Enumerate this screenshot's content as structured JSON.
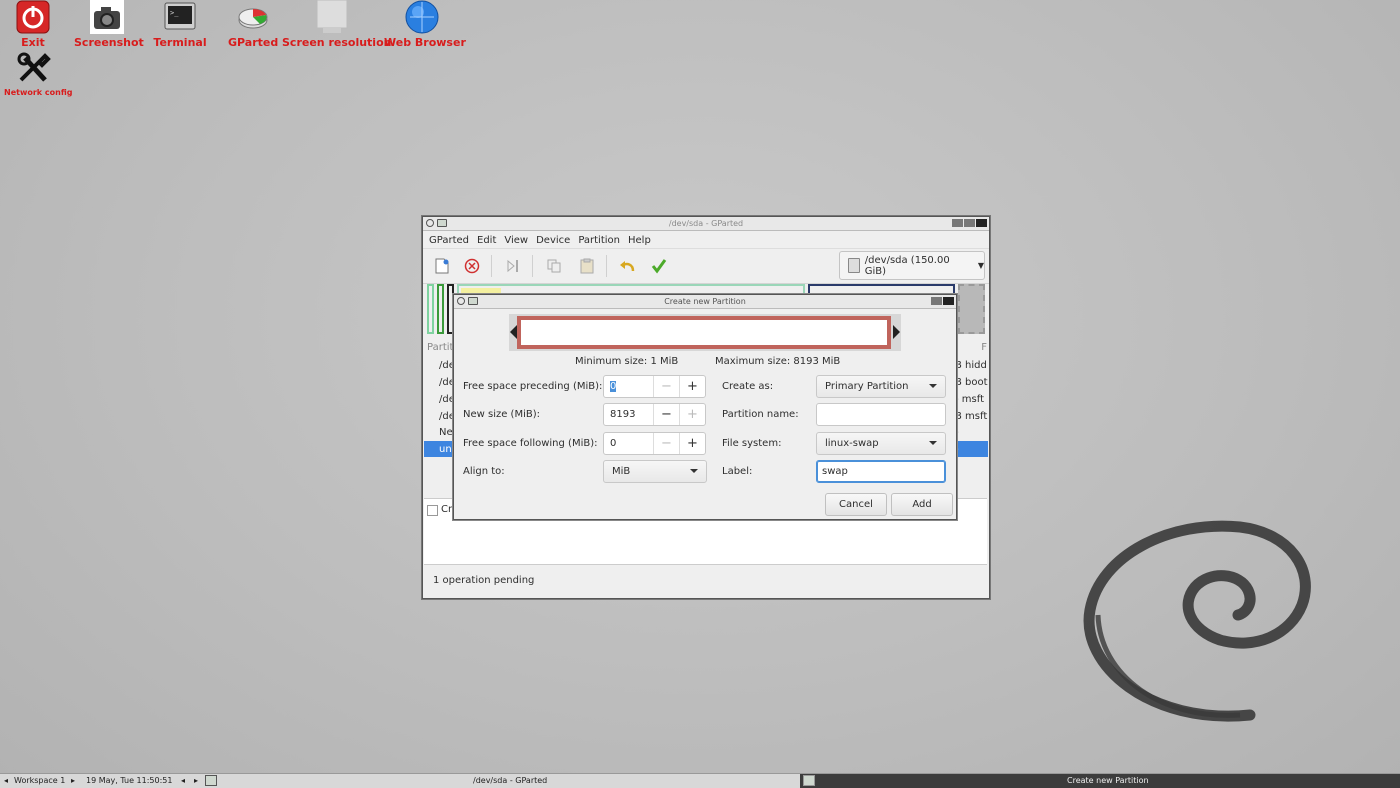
{
  "desktop": {
    "icons": [
      {
        "label": "Exit"
      },
      {
        "label": "Screenshot"
      },
      {
        "label": "Terminal"
      },
      {
        "label": "GParted"
      },
      {
        "label": "Screen resolution"
      },
      {
        "label": "Web Browser"
      },
      {
        "label": "Network config"
      }
    ]
  },
  "main_window": {
    "title": "/dev/sda - GParted",
    "menu": [
      "GParted",
      "Edit",
      "View",
      "Device",
      "Partition",
      "Help"
    ],
    "device_selector": "/dev/sda (150.00 GiB)",
    "list_header_left": "Partiti",
    "list_header_right": "F",
    "rows": [
      {
        "left": "/dev",
        "right": "B  hidd"
      },
      {
        "left": "/dev",
        "right": "B  boot"
      },
      {
        "left": "/dev",
        "right": "-  msft"
      },
      {
        "left": "/dev",
        "right": "B  msft"
      },
      {
        "left": "Nev",
        "right": "-"
      },
      {
        "left": "una",
        "right": "-"
      }
    ],
    "pending_op": "Cre",
    "status": "1 operation pending"
  },
  "dialog": {
    "title": "Create new Partition",
    "min_size": "Minimum size: 1 MiB",
    "max_size": "Maximum size: 8193 MiB",
    "labels": {
      "free_before": "Free space preceding (MiB):",
      "new_size": "New size (MiB):",
      "free_after": "Free space following (MiB):",
      "align": "Align to:",
      "create_as": "Create as:",
      "partition_name": "Partition name:",
      "file_system": "File system:",
      "label": "Label:"
    },
    "values": {
      "free_before": "0",
      "new_size": "8193",
      "free_after": "0",
      "align": "MiB",
      "create_as": "Primary Partition",
      "partition_name": "",
      "file_system": "linux-swap",
      "label": "swap"
    },
    "buttons": {
      "cancel": "Cancel",
      "add": "Add"
    }
  },
  "taskbar": {
    "workspace": "Workspace 1",
    "datetime": "19 May, Tue 11:50:51",
    "task1": "/dev/sda - GParted",
    "task2": "Create new Partition"
  },
  "colors": {
    "desktop_label": "#d81c1c",
    "selection": "#3d85e0",
    "partition_border": "#c0645c",
    "focus": "#4a90d9"
  }
}
